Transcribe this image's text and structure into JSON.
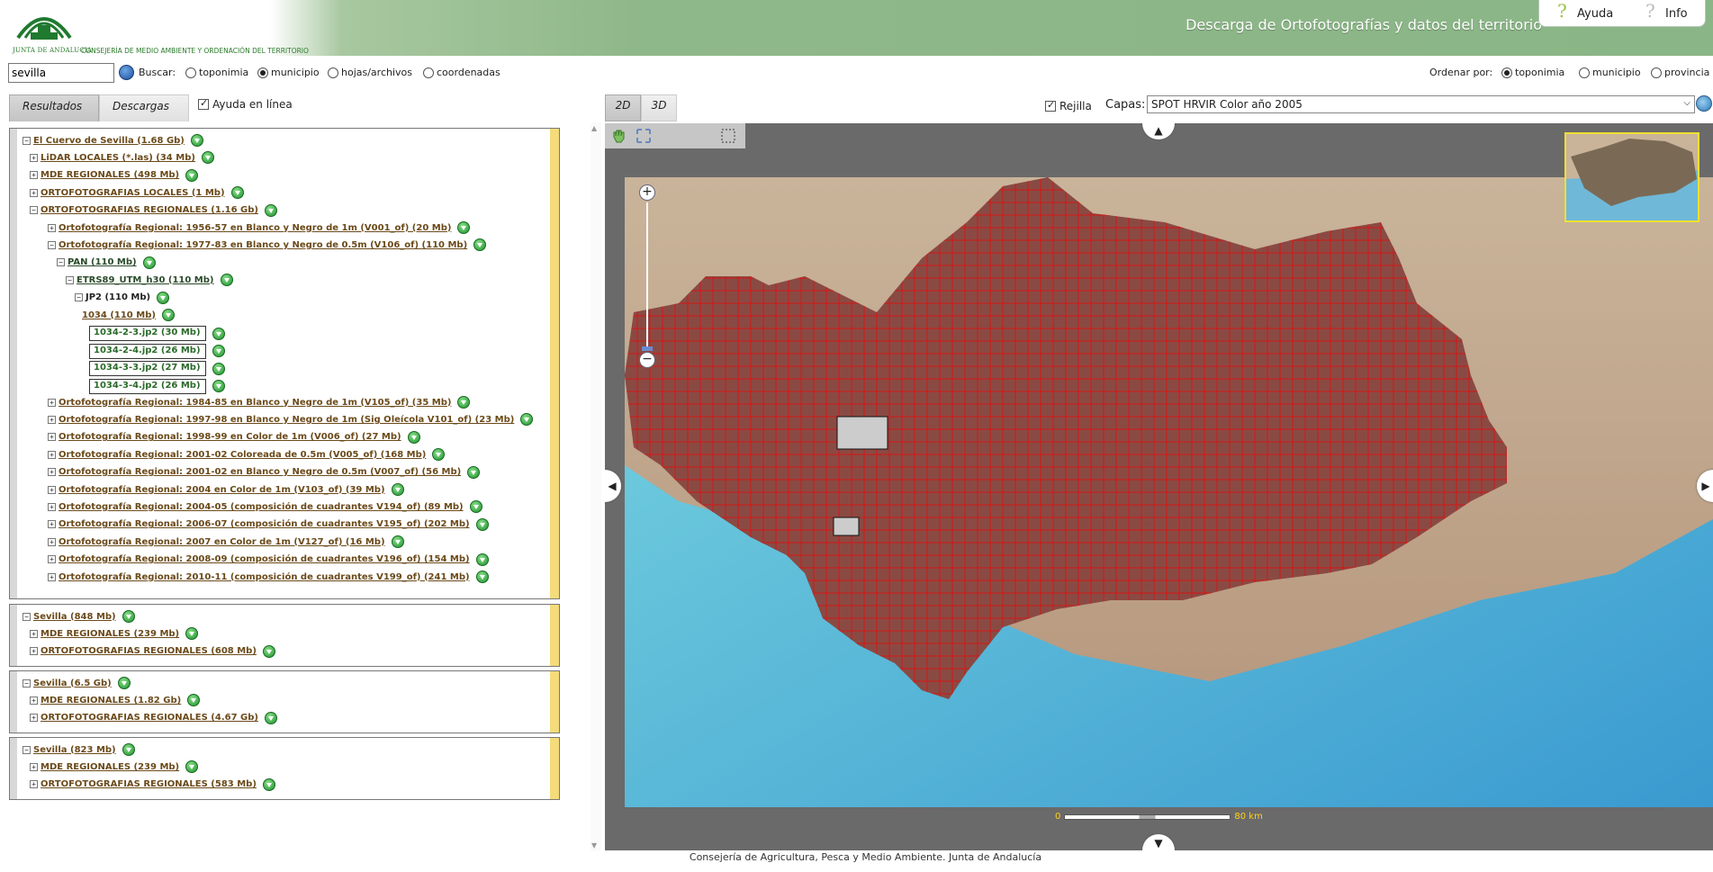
{
  "header": {
    "logo_text": "JUNTA DE ANDALUCIA",
    "logo_text2": "CONSEJERÍA DE MEDIO AMBIENTE Y ORDENACIÓN DEL TERRITORIO",
    "title": "Descarga de Ortofotografías y datos del territorio",
    "help_label": "Ayuda",
    "info_label": "Info"
  },
  "search": {
    "value": "sevilla",
    "buscar_label": "Buscar:",
    "options": [
      {
        "label": "toponimia",
        "selected": false
      },
      {
        "label": "municipio",
        "selected": true
      },
      {
        "label": "hojas/archivos",
        "selected": false
      },
      {
        "label": "coordenadas",
        "selected": false
      }
    ],
    "order_label": "Ordenar por:",
    "order_options": [
      {
        "label": "toponimia",
        "selected": true
      },
      {
        "label": "municipio",
        "selected": false
      },
      {
        "label": "provincia",
        "selected": false
      }
    ]
  },
  "tabs": {
    "results": "Resultados",
    "downloads": "Descargas",
    "online_help": "Ayuda en línea"
  },
  "groups": [
    {
      "items": [
        {
          "label": "El Cuervo de Sevilla (1.68 Gb)",
          "toggle": "−",
          "level": 0
        },
        {
          "label": "LiDAR LOCALES (*.las) (34 Mb)",
          "toggle": "+",
          "level": 1
        },
        {
          "label": "MDE REGIONALES (498 Mb)",
          "toggle": "+",
          "level": 1
        },
        {
          "label": "ORTOFOTOGRAFIAS LOCALES (1 Mb)",
          "toggle": "+",
          "level": 1
        },
        {
          "label": "ORTOFOTOGRAFIAS REGIONALES (1.16 Gb)",
          "toggle": "−",
          "level": 1
        },
        {
          "label": "Ortofotografía Regional: 1956-57 en Blanco y Negro de 1m (V001_of) (20 Mb)",
          "toggle": "+",
          "level": 2
        },
        {
          "label": "Ortofotografía Regional: 1977-83 en Blanco y Negro de 0.5m (V106_of) (110 Mb)",
          "toggle": "−",
          "level": 2
        },
        {
          "label": "PAN (110 Mb)",
          "toggle": "−",
          "level": 3
        },
        {
          "label": "ETRS89_UTM_h30 (110 Mb)",
          "toggle": "−",
          "level": 4
        },
        {
          "label": "JP2 (110 Mb)",
          "toggle": "−",
          "level": 5
        },
        {
          "label": "1034 (110 Mb)",
          "toggle": "",
          "level": 6
        },
        {
          "label": "1034-2-3.jp2 (30 Mb)",
          "toggle": "file",
          "level": 7
        },
        {
          "label": "1034-2-4.jp2 (26 Mb)",
          "toggle": "file",
          "level": 7
        },
        {
          "label": "1034-3-3.jp2 (27 Mb)",
          "toggle": "file",
          "level": 7
        },
        {
          "label": "1034-3-4.jp2 (26 Mb)",
          "toggle": "file",
          "level": 7
        },
        {
          "label": "Ortofotografía Regional: 1984-85 en Blanco y Negro de 1m (V105_of) (35 Mb)",
          "toggle": "+",
          "level": 2
        },
        {
          "label": "Ortofotografía Regional: 1997-98 en Blanco y Negro de 1m (Sig Oleícola V101_of) (23 Mb)",
          "toggle": "+",
          "level": 2
        },
        {
          "label": "Ortofotografía Regional: 1998-99 en Color de 1m (V006_of) (27 Mb)",
          "toggle": "+",
          "level": 2
        },
        {
          "label": "Ortofotografía Regional: 2001-02 Coloreada de 0.5m (V005_of) (168 Mb)",
          "toggle": "+",
          "level": 2
        },
        {
          "label": "Ortofotografía Regional: 2001-02 en Blanco y Negro de 0.5m (V007_of) (56 Mb)",
          "toggle": "+",
          "level": 2
        },
        {
          "label": "Ortofotografía Regional: 2004 en Color de 1m (V103_of) (39 Mb)",
          "toggle": "+",
          "level": 2
        },
        {
          "label": "Ortofotografía Regional: 2004-05 (composición de cuadrantes V194_of) (89 Mb)",
          "toggle": "+",
          "level": 2
        },
        {
          "label": "Ortofotografía Regional: 2006-07 (composición de cuadrantes V195_of) (202 Mb)",
          "toggle": "+",
          "level": 2
        },
        {
          "label": "Ortofotografía Regional: 2007 en Color de 1m (V127_of) (16 Mb)",
          "toggle": "+",
          "level": 2
        },
        {
          "label": "Ortofotografía Regional: 2008-09 (composición de cuadrantes V196_of) (154 Mb)",
          "toggle": "+",
          "level": 2
        },
        {
          "label": "Ortofotografía Regional: 2010-11 (composición de cuadrantes V199_of) (241 Mb)",
          "toggle": "+",
          "level": 2
        }
      ]
    },
    {
      "items": [
        {
          "label": "Sevilla (848 Mb)",
          "toggle": "−",
          "level": 0
        },
        {
          "label": "MDE REGIONALES (239 Mb)",
          "toggle": "+",
          "level": 1
        },
        {
          "label": "ORTOFOTOGRAFIAS REGIONALES (608 Mb)",
          "toggle": "+",
          "level": 1
        }
      ]
    },
    {
      "items": [
        {
          "label": "Sevilla (6.5 Gb)",
          "toggle": "−",
          "level": 0
        },
        {
          "label": "MDE REGIONALES (1.82 Gb)",
          "toggle": "+",
          "level": 1
        },
        {
          "label": "ORTOFOTOGRAFIAS REGIONALES (4.67 Gb)",
          "toggle": "+",
          "level": 1
        }
      ]
    },
    {
      "items": [
        {
          "label": "Sevilla (823 Mb)",
          "toggle": "−",
          "level": 0
        },
        {
          "label": "MDE REGIONALES (239 Mb)",
          "toggle": "+",
          "level": 1
        },
        {
          "label": "ORTOFOTOGRAFIAS REGIONALES (583 Mb)",
          "toggle": "+",
          "level": 1
        }
      ]
    }
  ],
  "map": {
    "tab_2d": "2D",
    "tab_3d": "3D",
    "grid_label": "Rejilla",
    "layers_label": "Capas:",
    "layer_selected": "SPOT HRVIR Color año 2005",
    "scale_start": "0",
    "scale_end": "80 km"
  },
  "footer": "Consejería de Agricultura, Pesca y Medio Ambiente. Junta de Andalucía",
  "colors": {
    "header_green": "#8ab586",
    "tile_red": "#d01818",
    "sea": "#6fc8d8",
    "link_brown": "#6b4a1a",
    "download_green": "#1c8f2c"
  }
}
